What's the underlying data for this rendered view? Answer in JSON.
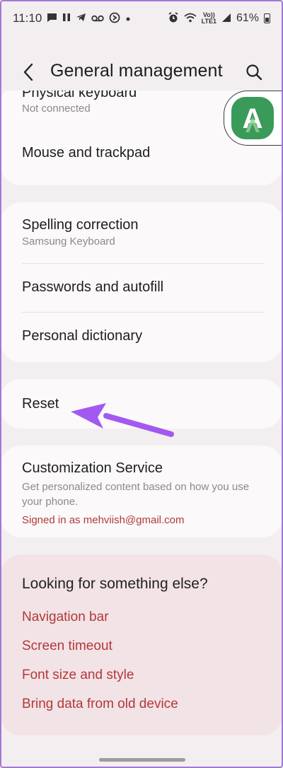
{
  "status_bar": {
    "time": "11:10",
    "network_label_top": "Vo))",
    "network_label_bottom": "LTE1",
    "battery": "61%"
  },
  "header": {
    "title": "General management",
    "back_icon": "chevron-left-icon",
    "search_icon": "search-icon"
  },
  "group1": {
    "physical_keyboard": {
      "title": "Physical keyboard",
      "subtitle": "Not connected"
    },
    "mouse_trackpad": {
      "title": "Mouse and trackpad"
    }
  },
  "group2": {
    "spelling": {
      "title": "Spelling correction",
      "subtitle": "Samsung Keyboard"
    },
    "passwords": {
      "title": "Passwords and autofill"
    },
    "dictionary": {
      "title": "Personal dictionary"
    }
  },
  "reset": {
    "title": "Reset"
  },
  "customization": {
    "title": "Customization Service",
    "description": "Get personalized content based on how you use your phone.",
    "signed_in": "Signed in as mehviish@gmail.com"
  },
  "looking": {
    "title": "Looking for something else?",
    "links": [
      "Navigation bar",
      "Screen timeout",
      "Font size and style",
      "Bring data from old device"
    ]
  },
  "overlay": {
    "app_icon_letter": "A",
    "app_icon_color": "#3a9a5a",
    "arrow_color": "#a259f0"
  },
  "colors": {
    "background": "#f3eff1",
    "card": "#fbf9fa",
    "looking_bg": "#f2e3e6",
    "link": "#b3383a"
  }
}
